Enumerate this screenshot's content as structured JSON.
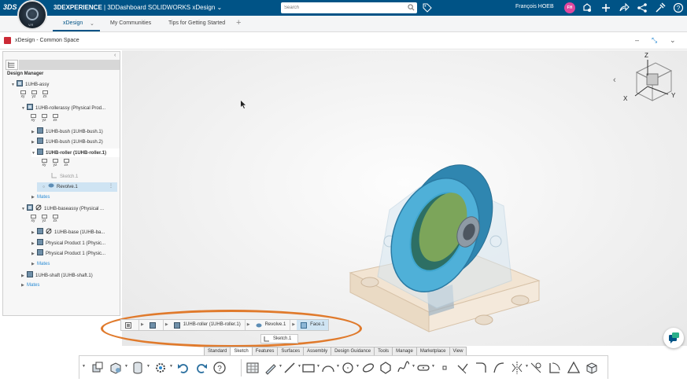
{
  "topbar": {
    "brand_bold": "3DEXPERIENCE",
    "brand_rest": " | 3DDashboard  SOLIDWORKS xDesign",
    "brand_chevron": "⌄",
    "search_placeholder": "Search",
    "user_name": "François HOEB",
    "avatar_initials": "FH",
    "compass_label": "V.R"
  },
  "tabs": {
    "active": "xDesign",
    "items": [
      "My Communities",
      "Tips for Getting Started"
    ]
  },
  "app": {
    "title": "xDesign - Common Space"
  },
  "design_manager": {
    "header": "Design Manager",
    "planes": [
      "xy",
      "yz",
      "zx"
    ],
    "tree": [
      {
        "label": "1UHB-assy"
      },
      {
        "label": "1UHB-rollerassy (Physical Prod..."
      },
      {
        "label": "1UHB-bush (1UHB-bush.1)"
      },
      {
        "label": "1UHB-bush (1UHB-bush.2)"
      },
      {
        "label": "1UHB-roller (1UHB-roller.1)"
      },
      {
        "label": "Sketch.1"
      },
      {
        "label": "Revolve.1"
      },
      {
        "label": "Mates"
      },
      {
        "label": "1UHB-baseassy (Physical ..."
      },
      {
        "label": "1UHB-base (1UHB-ba..."
      },
      {
        "label": "Physical Product 1 (Physic..."
      },
      {
        "label": "Physical Product 1 (Physic..."
      },
      {
        "label": "Mates"
      },
      {
        "label": "1UHB-shaft (1UHB-shaft.1)"
      },
      {
        "label": "Mates"
      }
    ]
  },
  "navcube": {
    "x": "X",
    "y": "Y",
    "z": "Z"
  },
  "breadcrumb": {
    "items": [
      "1UHB-roller (1UHB-roller.1)",
      "Revolve.1",
      "Face.1"
    ],
    "popup": "Sketch.1"
  },
  "command_tabs": [
    "Standard",
    "Sketch",
    "Features",
    "Surfaces",
    "Assembly",
    "Design Guidance",
    "Tools",
    "Manage",
    "Marketplace",
    "View"
  ],
  "colors": {
    "topbar": "#005386",
    "accent": "#2a8bd4",
    "highlight": "#e07a2c",
    "roller": "#3f9fc8",
    "avatar": "#e0479e"
  }
}
